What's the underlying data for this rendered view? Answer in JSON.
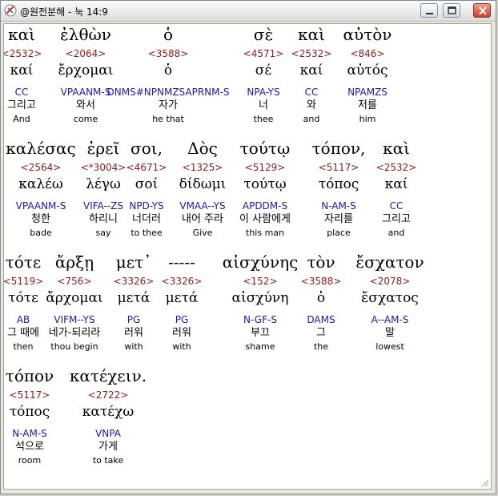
{
  "window": {
    "title": "@원전분해 - 눅 14:9",
    "minimize_label": "minimize",
    "maximize_label": "maximize",
    "close_label": "close"
  },
  "lines": [
    {
      "words": [
        {
          "greek": "καὶ",
          "num": "<2532>",
          "lemma": "καί",
          "morph": "CC",
          "ko": "그리고",
          "en": "And"
        },
        {
          "greek": "ἐλθὼν",
          "num": "<2064>",
          "lemma": "ἔρχομαι",
          "morph": "VPAANM-S",
          "ko": "와서",
          "en": "come"
        },
        {
          "greek": "ὁ",
          "num": "<3588>",
          "lemma": "ὁ",
          "morph": "DNMS#NPNMZSAPRNM-S",
          "ko": "자가",
          "en": "he that"
        },
        {
          "greek": "σὲ",
          "num": "<4571>",
          "lemma": "σέ",
          "morph": "NPA-YS",
          "ko": "너",
          "en": "thee"
        },
        {
          "greek": "καὶ",
          "num": "<2532>",
          "lemma": "καί",
          "morph": "CC",
          "ko": "와",
          "en": "and"
        },
        {
          "greek": "αὐτὸν",
          "num": "<846>",
          "lemma": "αὐτός",
          "morph": "NPAMZS",
          "ko": "저를",
          "en": "him"
        }
      ]
    },
    {
      "words": [
        {
          "greek": "καλέσας",
          "num": "<2564>",
          "lemma": "καλέω",
          "morph": "VPAANM-S",
          "ko": "청한",
          "en": "bade"
        },
        {
          "greek": "ἐρεῖ",
          "num": "<*3004>",
          "lemma": "λέγω",
          "morph": "VIFA--ZS",
          "ko": "하리니",
          "en": "say"
        },
        {
          "greek": "σοι,",
          "num": "<4671>",
          "lemma": "σοί",
          "morph": "NPD-YS",
          "ko": "너더러",
          "en": "to thee"
        },
        {
          "greek": "Δὸς",
          "num": "<1325>",
          "lemma": "δίδωμι",
          "morph": "VMAA--YS",
          "ko": "내어 주라",
          "en": "Give"
        },
        {
          "greek": "τούτῳ",
          "num": "<5129>",
          "lemma": "τούτῳ",
          "morph": "APDDM-S",
          "ko": "이 사람에게",
          "en": "this man"
        },
        {
          "greek": "τόπον,",
          "num": "<5117>",
          "lemma": "τόπος",
          "morph": "N-AM-S",
          "ko": "자리를",
          "en": "place"
        },
        {
          "greek": "καὶ",
          "num": "<2532>",
          "lemma": "καί",
          "morph": "CC",
          "ko": "그리고",
          "en": "and"
        }
      ]
    },
    {
      "words": [
        {
          "greek": "τότε",
          "num": "<5119>",
          "lemma": "τότε",
          "morph": "AB",
          "ko": "그 때에",
          "en": "then"
        },
        {
          "greek": "ἄρξῃ",
          "num": "<756>",
          "lemma": "ἄρχομαι",
          "morph": "VIFM--YS",
          "ko": "네가-되리라",
          "en": "thou begin"
        },
        {
          "greek": "μετ᾽",
          "num": "<3326>",
          "lemma": "μετά",
          "morph": "PG",
          "ko": "러워",
          "en": "with"
        },
        {
          "greek": "-----",
          "num": "<3326>",
          "lemma": "μετά",
          "morph": "PG",
          "ko": "러워",
          "en": "with"
        },
        {
          "greek": "αἰσχύνης",
          "num": "<152>",
          "lemma": "αἰσχύνη",
          "morph": "N-GF-S",
          "ko": "부끄",
          "en": "shame"
        },
        {
          "greek": "τὸν",
          "num": "<3588>",
          "lemma": "ὁ",
          "morph": "DAMS",
          "ko": "그",
          "en": "the"
        },
        {
          "greek": "ἔσχατον",
          "num": "<2078>",
          "lemma": "ἔσχατος",
          "morph": "A--AM-S",
          "ko": "말",
          "en": "lowest"
        }
      ]
    },
    {
      "words": [
        {
          "greek": "τόπον",
          "num": "<5117>",
          "lemma": "τόπος",
          "morph": "N-AM-S",
          "ko": "석으로",
          "en": "room"
        },
        {
          "greek": "κατέχειν.",
          "num": "<2722>",
          "lemma": "κατέχω",
          "morph": "VNPA",
          "ko": "가게",
          "en": "to take"
        }
      ]
    }
  ]
}
